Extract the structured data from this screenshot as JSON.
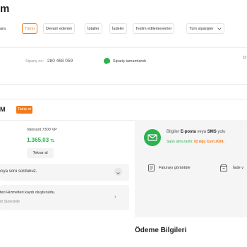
{
  "page_title_fragment": "m",
  "filters": {
    "prefix": "ara",
    "items": [
      {
        "label": "Tümü",
        "active": true
      },
      {
        "label": "Devam edenler",
        "active": false
      },
      {
        "label": "İptaller",
        "active": false
      },
      {
        "label": "İadeler",
        "active": false
      },
      {
        "label": "Teslim edilemeyenler",
        "active": false
      },
      {
        "label": "Tüm siparişler",
        "active": false
      }
    ],
    "dropdown_icon": "chevron-down-icon"
  },
  "order": {
    "number_label": "Sipariş no:",
    "number": "280 468 059",
    "status": "Sipariş tamamlandı",
    "corner_text": "D"
  },
  "seller": {
    "name_fragment": "M",
    "follow_label": "Takip et"
  },
  "product": {
    "name": "Valorant 7300 VP",
    "price": "1.365,03",
    "currency": "TL",
    "reorder_label": "Tekrar al"
  },
  "question_card": {
    "text": "cıya soru sordunuz."
  },
  "support_card": {
    "line1": "teri Hizmetleri kaydı oluşturuldu.",
    "line2": "m Sürecinde"
  },
  "delivery": {
    "line1_prefix": "Bilgiler",
    "email_label": "E-posta",
    "line1_mid": "veya",
    "sms_label": "SMS",
    "line1_suffix": "yolu",
    "line2_prefix": "Satın alma tarihi:",
    "line2_date": "02 Ağu Cum 2024,"
  },
  "actions": {
    "invoice_label": "Faturayı görüntüle",
    "return_label": "İade v"
  },
  "payment": {
    "title": "Ödeme Bilgileri"
  },
  "colors": {
    "accent_orange": "#f27a1a",
    "success_green": "#2bb24c"
  }
}
